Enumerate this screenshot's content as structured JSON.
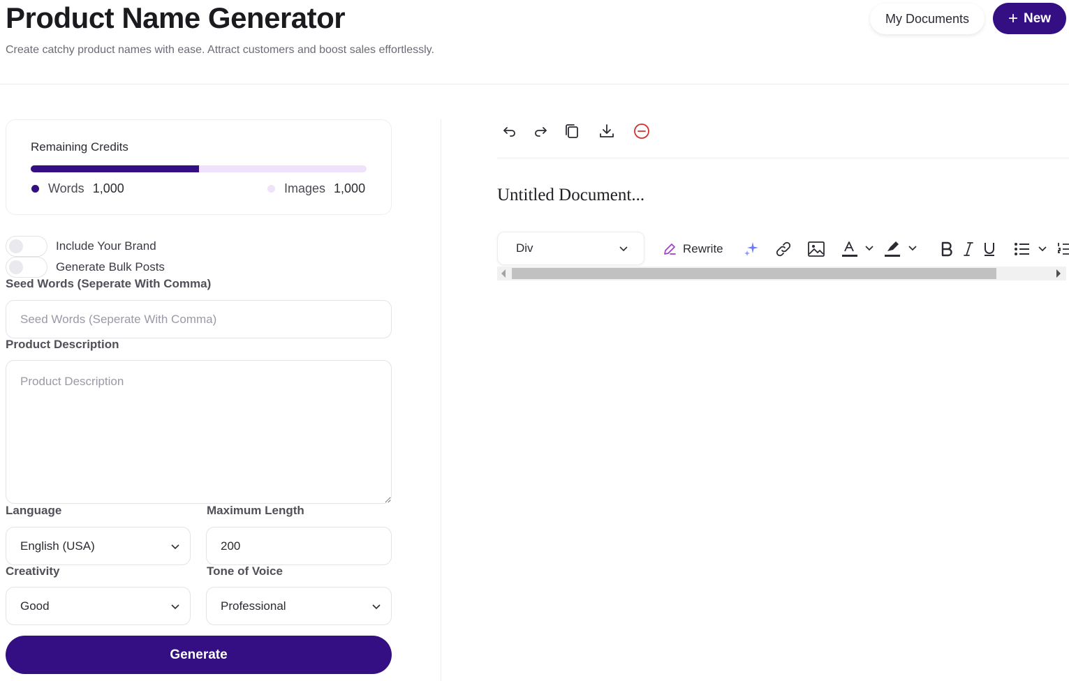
{
  "header": {
    "title": "Product Name Generator",
    "subtitle": "Create catchy product names with ease. Attract customers and boost sales effortlessly.",
    "my_documents_label": "My Documents",
    "new_label": "New"
  },
  "credits": {
    "label": "Remaining Credits",
    "words_fraction": 0.5,
    "words_label": "Words",
    "words_value": "1,000",
    "images_label": "Images",
    "images_value": "1,000",
    "words_color": "#330f83",
    "images_color": "#f1e2fb"
  },
  "form": {
    "include_brand_label": "Include Your Brand",
    "include_brand_on": false,
    "bulk_posts_label": "Generate Bulk Posts",
    "bulk_posts_on": false,
    "seed_words_label": "Seed Words (Seperate With Comma)",
    "seed_words_placeholder": "Seed Words (Seperate With Comma)",
    "product_description_label": "Product Description",
    "product_description_placeholder": "Product Description",
    "language_label": "Language",
    "language_value": "English (USA)",
    "max_length_label": "Maximum Length",
    "max_length_value": "200",
    "creativity_label": "Creativity",
    "creativity_value": "Good",
    "tone_label": "Tone of Voice",
    "tone_value": "Professional",
    "generate_label": "Generate"
  },
  "editor": {
    "toolbar_icons": [
      "undo-icon",
      "redo-icon",
      "copy-icon",
      "download-icon",
      "clear-icon"
    ],
    "document_title": "Untitled Document...",
    "block_format_value": "Div",
    "rewrite_label": "Rewrite"
  },
  "colors": {
    "accent": "#330f83",
    "clear_icon": "#d32f2f",
    "sparkle_icon": "#6b7bff",
    "rewrite_icon": "#a03ec8"
  }
}
